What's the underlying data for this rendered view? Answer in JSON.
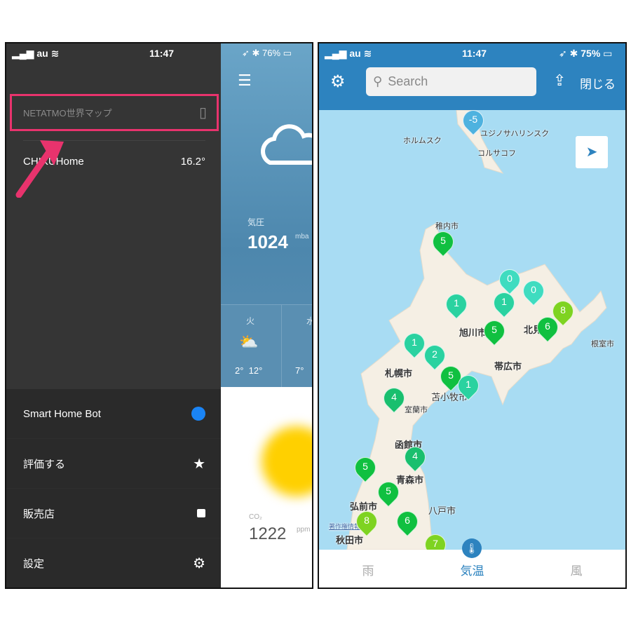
{
  "left_screen": {
    "status": {
      "carrier": "au",
      "time": "11:47",
      "battery": "76%"
    },
    "drawer": {
      "world_map_label": "NETATMO世界マップ",
      "station_name": "CHIKUHome",
      "station_temp": "16.2°",
      "menu": [
        {
          "label": "Smart Home Bot",
          "icon": "messenger-icon"
        },
        {
          "label": "評価する",
          "icon": "star-icon"
        },
        {
          "label": "販売店",
          "icon": "lock-icon"
        },
        {
          "label": "設定",
          "icon": "gear-icon"
        }
      ]
    },
    "weather": {
      "pressure_label": "気圧",
      "pressure_value": "1024",
      "pressure_unit": "mba",
      "forecast": [
        {
          "day": "火",
          "low": "2°",
          "high": "12°"
        },
        {
          "day": "水",
          "low": "7°"
        }
      ],
      "co2_label": "CO₂",
      "co2_value": "1222",
      "co2_unit": "ppm"
    },
    "annotation_color": "#e8336d"
  },
  "right_screen": {
    "status": {
      "carrier": "au",
      "time": "11:47",
      "battery": "75%"
    },
    "search_placeholder": "Search",
    "close_label": "閉じる",
    "header_color": "#2d83bf",
    "cities": [
      "ホルムスク",
      "ユジノサハリンスク",
      "コルサコフ",
      "稚内市",
      "旭川市",
      "北見市",
      "根室市",
      "札幌市",
      "帯広市",
      "苫小牧市",
      "室蘭市",
      "函館市",
      "青森市",
      "弘前市",
      "八戸市",
      "秋田市"
    ],
    "copyright_link": "著作権情報",
    "markers": [
      "-5",
      "5",
      "0",
      "0",
      "1",
      "1",
      "8",
      "5",
      "6",
      "1",
      "2",
      "5",
      "1",
      "4",
      "4",
      "5",
      "5",
      "6",
      "8",
      "7"
    ],
    "tabs": [
      "雨",
      "気温",
      "風"
    ],
    "active_tab": "気温"
  }
}
